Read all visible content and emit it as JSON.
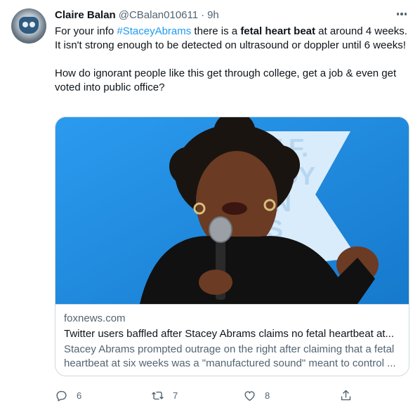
{
  "tweet": {
    "author_name": "Claire Balan",
    "author_handle": "@CBalan010611",
    "separator": "·",
    "time": "9h",
    "text_prefix": "For your info ",
    "hashtag": "#StaceyAbrams",
    "text_mid": " there is a ",
    "bold_phrase": "fetal heart beat",
    "text_suffix": " at around 4 weeks. It isn't strong enough to be detected on ultrasound or doppler until 6 weeks!",
    "paragraph2": "How do ignorant people like this get through college, get a job & even get voted into public office?"
  },
  "card": {
    "domain": "foxnews.com",
    "title": "Twitter users baffled after Stacey Abrams claims no fetal heartbeat at...",
    "description": "Stacey Abrams prompted outrage on the right after claiming that a fetal heartbeat at six weeks was a \"manufactured sound\" meant to control ...",
    "backdrop_text": [
      "T F.",
      "DY",
      "N",
      "S"
    ]
  },
  "actions": {
    "reply_count": "6",
    "retweet_count": "7",
    "like_count": "8"
  },
  "icons": {
    "more": "more-dots-icon",
    "reply": "reply-icon",
    "retweet": "retweet-icon",
    "like": "heart-icon",
    "share": "share-icon"
  },
  "colors": {
    "accent": "#1d9bf0",
    "secondary_text": "#536471",
    "primary_text": "#0f1419",
    "border": "#cfd9de",
    "card_image_blue": "#1f8ee0"
  }
}
